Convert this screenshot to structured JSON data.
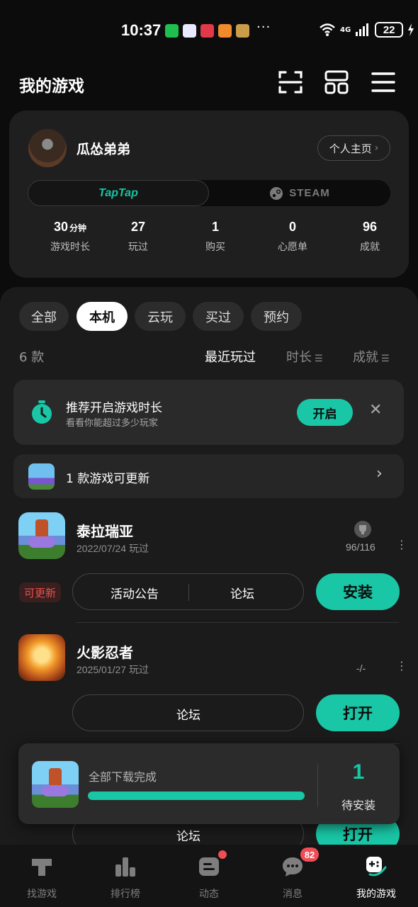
{
  "status_bar": {
    "time": "10:37",
    "more": "···",
    "network": "4G",
    "battery": "22"
  },
  "header": {
    "title": "我的游戏",
    "icons": [
      "scan-icon",
      "grid-icon",
      "menu-icon"
    ]
  },
  "profile": {
    "username": "瓜怂弟弟",
    "home_button": "个人主页",
    "platform_tabs": [
      {
        "label": "TapTap",
        "active": true
      },
      {
        "label": "STEAM",
        "active": false
      }
    ],
    "stats": [
      {
        "value": "30",
        "unit": "分钟",
        "label": "游戏时长"
      },
      {
        "value": "27",
        "unit": "",
        "label": "玩过"
      },
      {
        "value": "1",
        "unit": "",
        "label": "购买"
      },
      {
        "value": "0",
        "unit": "",
        "label": "心愿单"
      },
      {
        "value": "96",
        "unit": "",
        "label": "成就"
      }
    ]
  },
  "filters": {
    "chips": [
      {
        "label": "全部",
        "active": false
      },
      {
        "label": "本机",
        "active": true
      },
      {
        "label": "云玩",
        "active": false
      },
      {
        "label": "买过",
        "active": false
      },
      {
        "label": "预约",
        "active": false
      }
    ],
    "count": "6 款",
    "sorts": [
      {
        "label": "最近玩过",
        "active": true
      },
      {
        "label": "时长",
        "active": false
      },
      {
        "label": "成就",
        "active": false
      }
    ]
  },
  "recommend": {
    "title": "推荐开启游戏时长",
    "subtitle": "看看你能超过多少玩家",
    "button": "开启"
  },
  "update_row": {
    "text": "1 款游戏可更新"
  },
  "games": [
    {
      "name": "泰拉瑞亚",
      "meta": "2022/07/24 玩过",
      "achievements": "96/116",
      "badge": "可更新",
      "links": [
        "活动公告",
        "论坛"
      ],
      "action": "安装"
    },
    {
      "name": "火影忍者",
      "meta": "2025/01/27 玩过",
      "achievements": "-/-",
      "links": [
        "论坛"
      ],
      "action": "打开"
    },
    {
      "links": [
        "论坛"
      ],
      "action": "打开"
    }
  ],
  "download_toast": {
    "text": "全部下载完成",
    "progress": 1.0,
    "count": "1",
    "count_label": "待安装"
  },
  "bottom_nav": [
    {
      "label": "找游戏",
      "icon": "discover-icon",
      "active": false
    },
    {
      "label": "排行榜",
      "icon": "leaderboard-icon",
      "active": false
    },
    {
      "label": "动态",
      "icon": "feed-icon",
      "active": false,
      "dot": true
    },
    {
      "label": "消息",
      "icon": "message-icon",
      "active": false,
      "badge": "82"
    },
    {
      "label": "我的游戏",
      "icon": "my-games-icon",
      "active": true
    }
  ],
  "colors": {
    "accent": "#19c7a6",
    "badge_red": "#f04d57",
    "update_red": "#e6524e"
  }
}
